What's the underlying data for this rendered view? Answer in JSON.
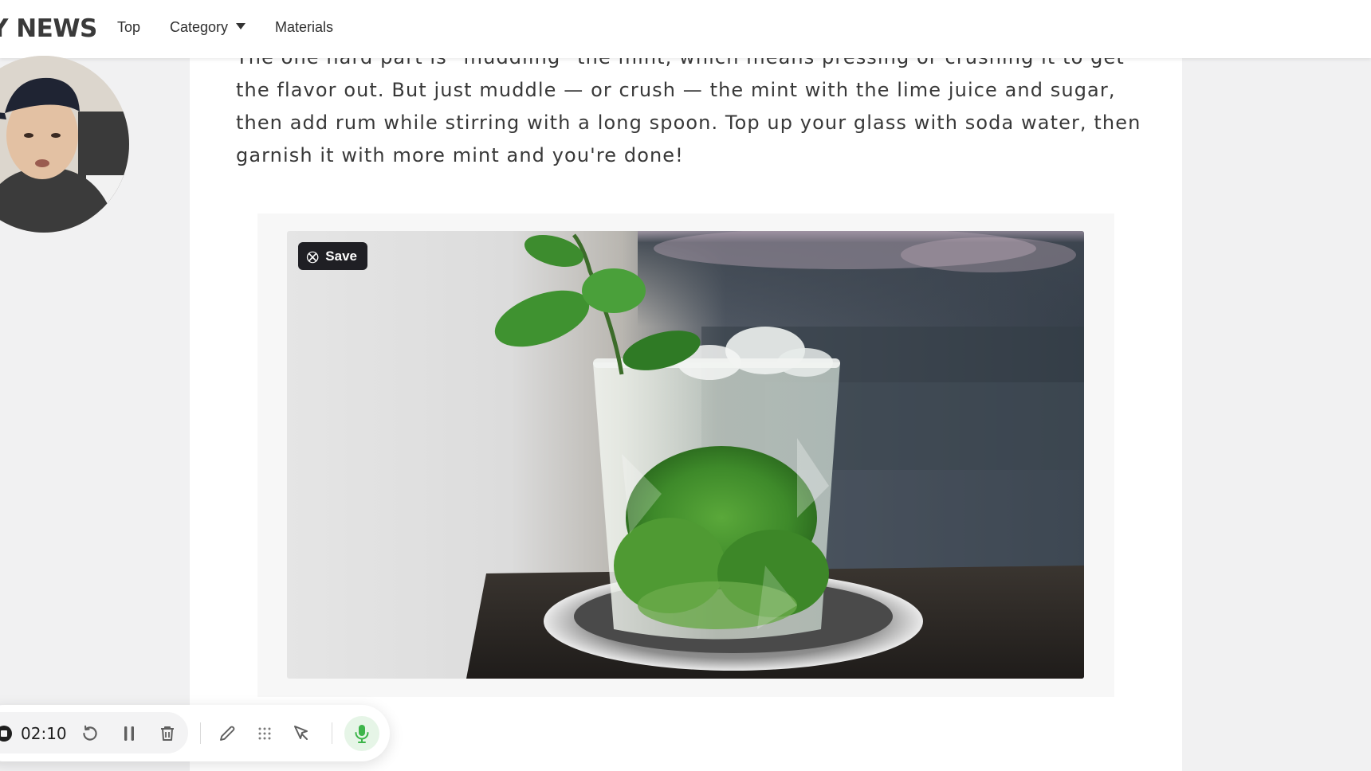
{
  "header": {
    "brand": "Y NEWS",
    "nav": {
      "top": "Top",
      "category": "Category",
      "materials": "Materials"
    }
  },
  "article": {
    "paragraph": "The one hard part is \"muddling\" the mint, which means pressing or crushing it to get the flavor out. But just muddle — or crush — the mint with the lime juice and sugar, then add rum while stirring with a long spoon. Top up your glass with soda water, then garnish it with more mint and you're done!",
    "image": {
      "subject": "mojito-glass-with-mint",
      "save_label": "Save",
      "save_icon": "pin-icon"
    }
  },
  "recorder": {
    "elapsed": "02:10",
    "icons": [
      "stop-icon",
      "restart-icon",
      "pause-icon",
      "trash-icon",
      "pen-icon",
      "grid-dots-icon",
      "cursor-icon",
      "microphone-icon"
    ],
    "mic_color": "#3db54a"
  }
}
